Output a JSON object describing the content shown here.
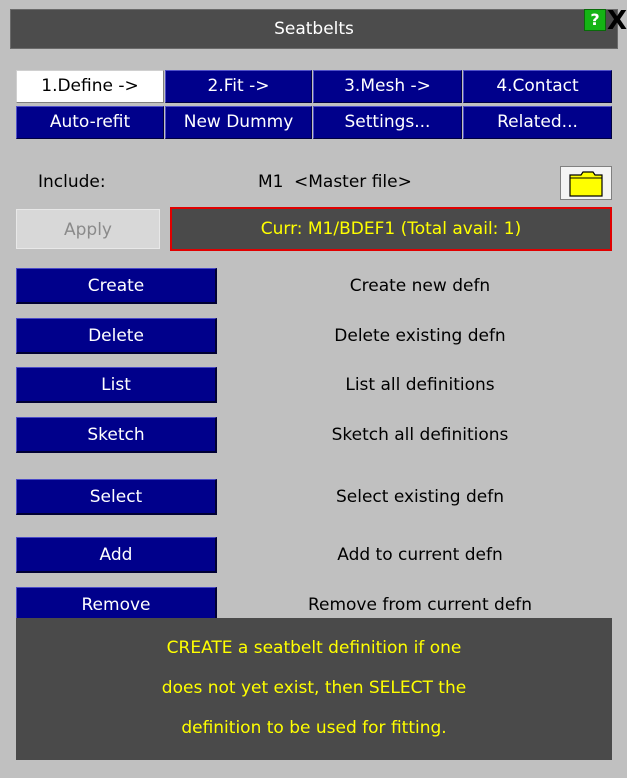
{
  "window": {
    "title": "Seatbelts",
    "help_label": "?",
    "close_label": "X"
  },
  "tabs_row1": [
    {
      "label": "1.Define ->",
      "active": true
    },
    {
      "label": "2.Fit ->"
    },
    {
      "label": "3.Mesh ->"
    },
    {
      "label": "4.Contact"
    }
  ],
  "tabs_row2": [
    {
      "label": "Auto-refit"
    },
    {
      "label": "New Dummy"
    },
    {
      "label": "Settings..."
    },
    {
      "label": "Related..."
    }
  ],
  "include": {
    "label": "Include:",
    "model": "M1",
    "file": "<Master file>"
  },
  "apply_label": "Apply",
  "current": "Curr: M1/BDEF1 (Total avail: 1)",
  "actions": [
    {
      "button": "Create",
      "desc": "Create new defn"
    },
    {
      "button": "Delete",
      "desc": "Delete existing defn"
    },
    {
      "button": "List",
      "desc": "List all definitions"
    },
    {
      "button": "Sketch",
      "desc": "Sketch all definitions"
    },
    {
      "button": "Select",
      "desc": "Select existing defn"
    },
    {
      "button": "Add",
      "desc": "Add to current defn"
    },
    {
      "button": "Remove",
      "desc": "Remove from current defn"
    }
  ],
  "info_lines": [
    "CREATE a seatbelt definition if one",
    "does not yet exist, then SELECT the",
    "definition to be used for fitting."
  ],
  "colors": {
    "button_blue": "#00008b",
    "info_text": "#ffff00",
    "border_red": "#e00000",
    "help_green": "#14b414"
  },
  "icons": {
    "folder": "folder-icon",
    "help": "help-icon",
    "close": "close-icon"
  }
}
